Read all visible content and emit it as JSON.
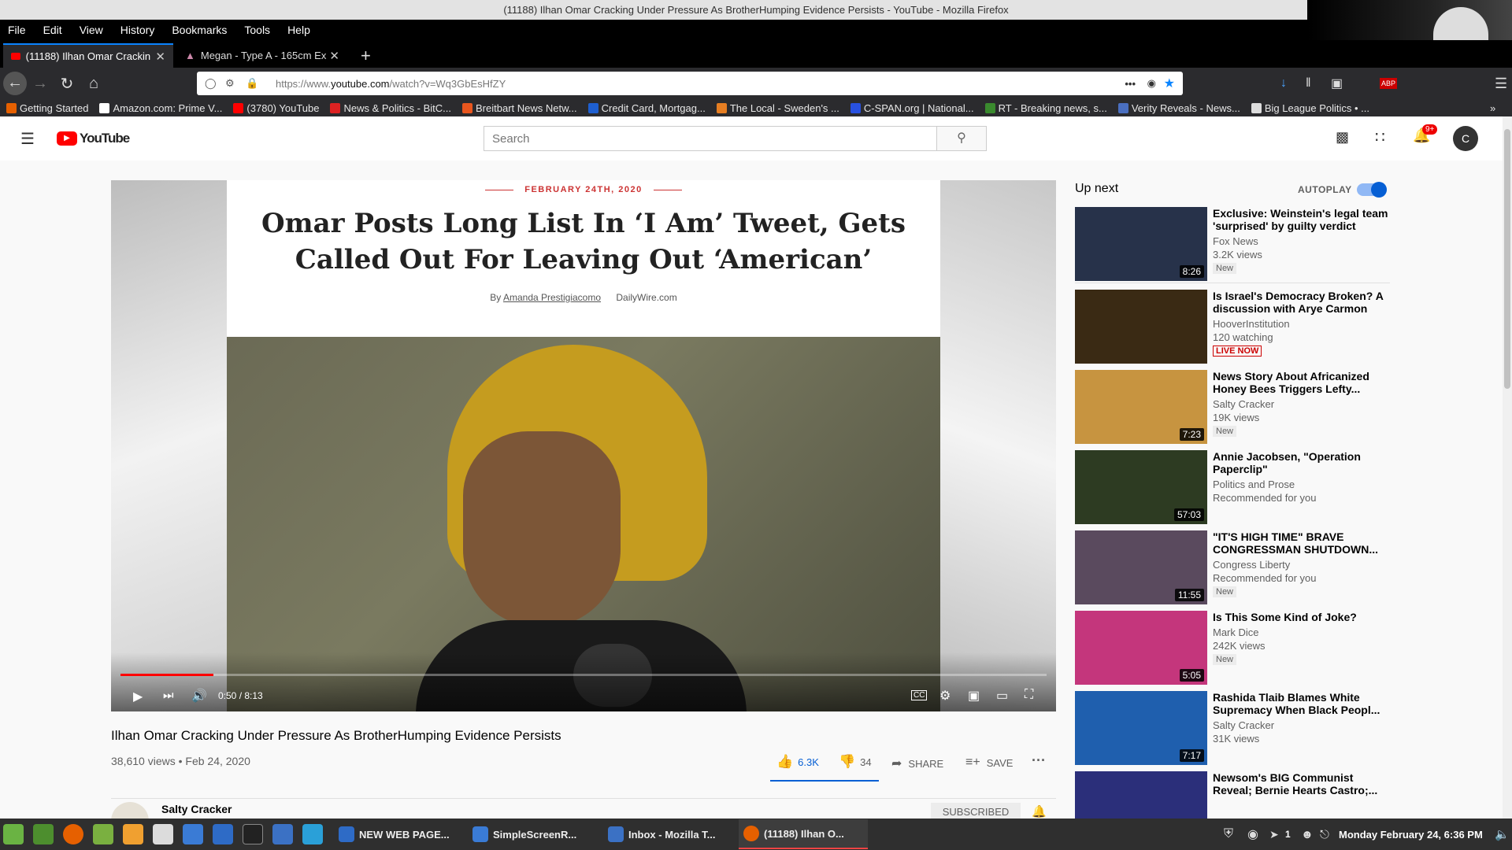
{
  "window": {
    "title": "(11188) Ilhan Omar Cracking Under Pressure As BrotherHumping Evidence Persists - YouTube - Mozilla Firefox"
  },
  "menu": [
    "File",
    "Edit",
    "View",
    "History",
    "Bookmarks",
    "Tools",
    "Help"
  ],
  "tabs": [
    {
      "label": "(11188) Ilhan Omar Crackin"
    },
    {
      "label": "Megan - Type A - 165cm Ex"
    }
  ],
  "url": {
    "prefix": "https://www.",
    "domain": "youtube.com",
    "path": "/watch?v=Wq3GbEsHfZY"
  },
  "bookmarks": [
    "Getting Started",
    "Amazon.com: Prime V...",
    "(3780) YouTube",
    "News & Politics - BitC...",
    "Breitbart News Netw...",
    "Credit Card, Mortgag...",
    "The Local - Sweden's ...",
    "C-SPAN.org | National...",
    "RT - Breaking news, s...",
    "Verity Reveals - News...",
    "Big League Politics • ..."
  ],
  "youtube": {
    "logo": "YouTube",
    "search_placeholder": "Search",
    "notif_count": "9+",
    "avatar_letter": "C"
  },
  "video": {
    "article_date": "FEBRUARY 24TH, 2020",
    "article_title_1": "Omar Posts Long List In ‘I Am’ Tweet, Gets",
    "article_title_2": "Called Out For Leaving Out ‘American’",
    "article_by": "By",
    "article_author": "Amanda Prestigiacomo",
    "article_site": "DailyWire.com",
    "time": "0:50 / 8:13",
    "progress": 0.1,
    "title": "Ilhan Omar Cracking Under Pressure As BrotherHumping Evidence Persists",
    "views_date": "38,610 views • Feb 24, 2020",
    "likes": "6.3K",
    "dislikes": "34",
    "share": "SHARE",
    "save": "SAVE",
    "channel": "Salty Cracker",
    "subscribed": "SUBSCRIBED"
  },
  "upnext": {
    "label": "Up next",
    "autoplay": "AUTOPLAY"
  },
  "recommendations": [
    {
      "title": "Exclusive: Weinstein's legal team 'surprised' by guilty verdict",
      "channel": "Fox News",
      "views": "3.2K views",
      "badge": "New",
      "duration": "8:26",
      "color": "#27324a"
    },
    {
      "title": "Is Israel's Democracy Broken? A discussion with Arye Carmon",
      "channel": "HooverInstitution",
      "views": "120 watching",
      "badge": "LIVE NOW",
      "duration": "",
      "color": "#3a2a14"
    },
    {
      "title": "News Story About Africanized Honey Bees Triggers Lefty...",
      "channel": "Salty Cracker",
      "views": "19K views",
      "badge": "New",
      "duration": "7:23",
      "color": "#c79440"
    },
    {
      "title": "Annie Jacobsen, \"Operation Paperclip\"",
      "channel": "Politics and Prose",
      "views": "Recommended for you",
      "badge": "",
      "duration": "57:03",
      "color": "#2d3b22"
    },
    {
      "title": "\"IT'S HIGH TIME\" BRAVE CONGRESSMAN SHUTDOWN...",
      "channel": "Congress Liberty",
      "views": "Recommended for you",
      "badge": "New",
      "duration": "11:55",
      "color": "#5a4a5e"
    },
    {
      "title": "Is This Some Kind of Joke?",
      "channel": "Mark Dice",
      "views": "242K views",
      "badge": "New",
      "duration": "5:05",
      "color": "#c4367c"
    },
    {
      "title": "Rashida Tlaib Blames White Supremacy When Black Peopl...",
      "channel": "Salty Cracker",
      "views": "31K views",
      "badge": "",
      "duration": "7:17",
      "color": "#1f5fae"
    },
    {
      "title": "Newsom's BIG Communist Reveal; Bernie Hearts Castro;...",
      "channel": "",
      "views": "",
      "badge": "",
      "duration": "",
      "color": "#2b2f7a"
    }
  ],
  "taskbar": {
    "items": [
      "NEW WEB PAGE...",
      "SimpleScreenR...",
      "Inbox - Mozilla T...",
      "(11188) Ilhan O..."
    ],
    "workspace": "1",
    "clock": "Monday February 24,  6:36 PM"
  }
}
